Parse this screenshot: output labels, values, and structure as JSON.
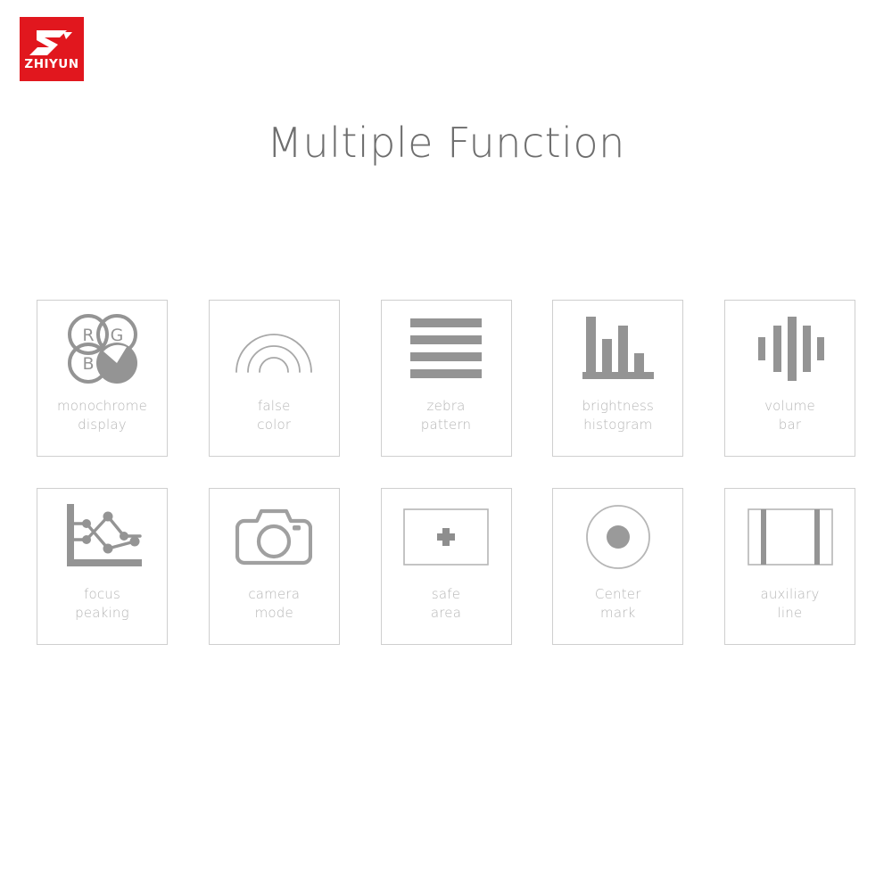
{
  "brand": {
    "name": "ZHIYUN",
    "logo_icon": "zhiyun-z-mark-icon",
    "background_color": "#e1171e",
    "text_color": "#ffffff"
  },
  "header": {
    "title": "Multiple Function",
    "title_color": "#6e6e6e"
  },
  "theme": {
    "page_background": "#ffffff",
    "card_border": "#cfcfcf",
    "icon_gray": "#949494",
    "icon_light_gray": "#b0b0b0",
    "label_gray": "#b6b6b6"
  },
  "features": [
    {
      "id": "monochrome-display",
      "icon": "rgb-circles-icon",
      "label": "monochrome\ndisplay",
      "label_line1": "monochrome",
      "label_line2": "display",
      "icon_detail": {
        "circles": [
          "R",
          "G",
          "B",
          ""
        ],
        "filled_circle_index": 3,
        "wedge": "white diagonal wedge upper-left"
      }
    },
    {
      "id": "false-color",
      "icon": "rainbow-arcs-icon",
      "label": "false\ncolor",
      "label_line1": "false",
      "label_line2": "color",
      "icon_detail": {
        "arc_count": 3
      }
    },
    {
      "id": "zebra-pattern",
      "icon": "horizontal-stripes-icon",
      "label": "zebra\npattern",
      "label_line1": "zebra",
      "label_line2": "pattern",
      "icon_detail": {
        "stripe_count": 4
      }
    },
    {
      "id": "brightness-histogram",
      "icon": "histogram-bars-icon",
      "label": "brightness\nhistogram",
      "label_line1": "brightness",
      "label_line2": "histogram",
      "icon_detail": {
        "bar_heights_pct": [
          100,
          62,
          85,
          38
        ]
      }
    },
    {
      "id": "volume-bar",
      "icon": "vertical-level-bars-icon",
      "label": "volume\nbar",
      "label_line1": "volume",
      "label_line2": "bar",
      "icon_detail": {
        "bar_heights_pct": [
          38,
          72,
          100,
          72,
          38
        ]
      }
    },
    {
      "id": "focus-peaking",
      "icon": "focus-peaking-graph-icon",
      "label": "focus\npeaking",
      "label_line1": "focus",
      "label_line2": "peaking",
      "icon_detail": {
        "axes": "L-shaped",
        "node_count": 6,
        "crossing_lines": 2
      }
    },
    {
      "id": "camera-mode",
      "icon": "camera-icon",
      "label": "camera\nmode",
      "label_line1": "camera",
      "label_line2": "mode",
      "icon_detail": {
        "lens": "circle",
        "flash": "small dot top-right"
      }
    },
    {
      "id": "safe-area",
      "icon": "frame-with-plus-icon",
      "label": "safe\narea",
      "label_line1": "safe",
      "label_line2": "area",
      "icon_detail": {
        "marker": "+"
      }
    },
    {
      "id": "center-mark",
      "icon": "center-dot-circle-icon",
      "label": "Center\nmark",
      "label_line1": "Center",
      "label_line2": "mark",
      "icon_detail": {
        "outer": "circle outline",
        "inner": "filled dot"
      }
    },
    {
      "id": "auxiliary-line",
      "icon": "frame-with-vertical-guides-icon",
      "label": "auxiliary\nline",
      "label_line1": "auxiliary",
      "label_line2": "line",
      "icon_detail": {
        "guide_count": 2
      }
    }
  ]
}
